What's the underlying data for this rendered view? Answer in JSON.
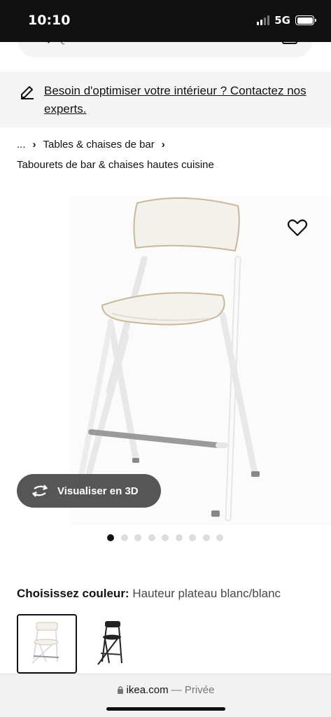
{
  "status_bar": {
    "time": "10:10",
    "network": "5G"
  },
  "search": {
    "placeholder": "Que cherchez-vous ?"
  },
  "banner": {
    "link_text": "Besoin d'optimiser votre intérieur ? Contactez nos experts."
  },
  "breadcrumb": {
    "ellipsis": "...",
    "items": [
      "Tables & chaises de bar"
    ],
    "current": "Tabourets de bar & chaises hautes cuisine"
  },
  "product": {
    "visualize_label": "Visualiser en 3D",
    "carousel": {
      "count": 9,
      "active_index": 0
    },
    "color_label": "Choisissez couleur:",
    "color_value": "Hauteur plateau blanc/blanc",
    "swatches": [
      {
        "name": "blanc/blanc",
        "selected": true
      },
      {
        "name": "noir",
        "selected": false
      }
    ]
  },
  "browser": {
    "domain": "ikea.com",
    "separator": "—",
    "mode": "Privée"
  },
  "colors": {
    "accent": "#111111",
    "banner_bg": "#f5f5f5",
    "button_bg": "#484848"
  }
}
